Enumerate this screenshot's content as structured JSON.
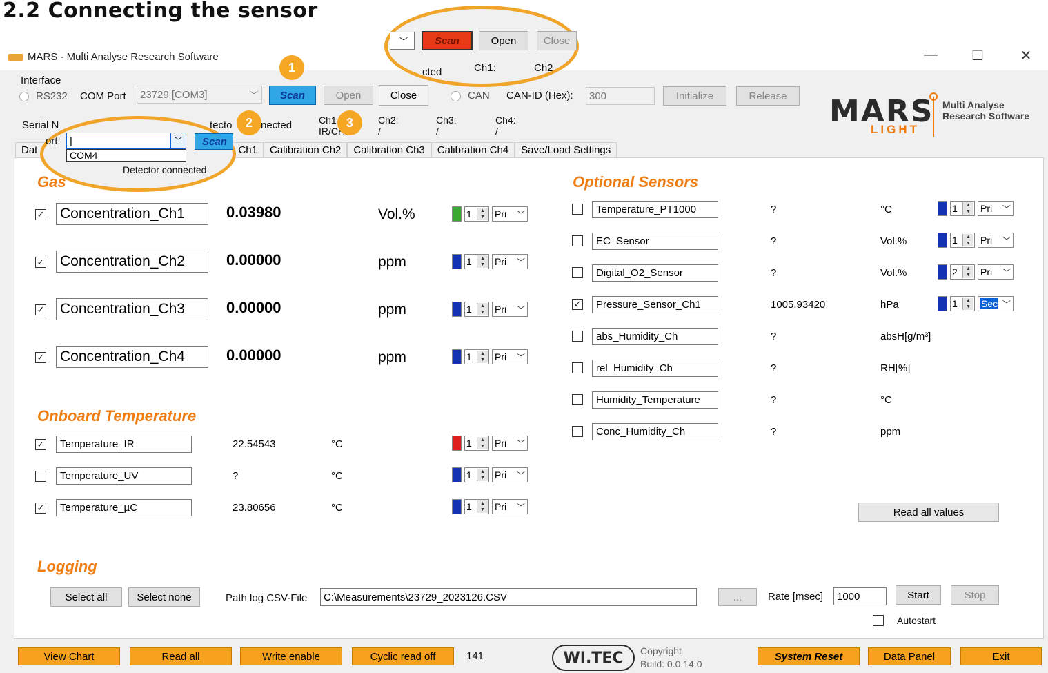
{
  "heading": "2.2 Connecting the sensor",
  "window": {
    "title": "MARS - Multi Analyse Research Software",
    "minimize": "—",
    "maximize": "☐",
    "close": "✕"
  },
  "interface": {
    "label": "Interface",
    "rs232": "RS232",
    "com_port_label": "COM Port",
    "com_port_value": "23729 [COM3]",
    "scan": "Scan",
    "open": "Open",
    "close": "Close",
    "can": "CAN",
    "can_id_label": "CAN-ID (Hex):",
    "can_id_value": "300",
    "initialize": "Initialize",
    "release": "Release"
  },
  "status_row": {
    "serial": "Serial N",
    "detector": "tecto",
    "connected": "nected",
    "ch1": "Ch1",
    "ch1_sub": "IR/CH4",
    "ch2": "Ch2:",
    "ch2_sub": "/",
    "ch3": "Ch3:",
    "ch3_sub": "/",
    "ch4": "Ch4:",
    "ch4_sub": "/"
  },
  "tabs": [
    "Dat",
    "Ch1",
    "Calibration Ch2",
    "Calibration Ch3",
    "Calibration Ch4",
    "Save/Load Settings"
  ],
  "zoom1": {
    "scan": "Scan",
    "open": "Open",
    "close": "Close",
    "connected": "cted",
    "ch1": "Ch1:",
    "ch2": "Ch2"
  },
  "zoom2": {
    "port": "ort",
    "value": "|",
    "option": "COM4",
    "scan": "Scan",
    "status": "Detector connected",
    "gas": "Gas"
  },
  "badges": [
    "1",
    "2",
    "3"
  ],
  "gas": {
    "rows": [
      {
        "checked": true,
        "name": "Concentration_Ch1",
        "value": "0.03980",
        "unit": "Vol.%",
        "color": "#3aa832",
        "num": "1",
        "prio": "Pri"
      },
      {
        "checked": true,
        "name": "Concentration_Ch2",
        "value": "0.00000",
        "unit": "ppm",
        "color": "#1432b4",
        "num": "1",
        "prio": "Pri"
      },
      {
        "checked": true,
        "name": "Concentration_Ch3",
        "value": "0.00000",
        "unit": "ppm",
        "color": "#1432b4",
        "num": "1",
        "prio": "Pri"
      },
      {
        "checked": true,
        "name": "Concentration_Ch4",
        "value": "0.00000",
        "unit": "ppm",
        "color": "#1432b4",
        "num": "1",
        "prio": "Pri"
      }
    ]
  },
  "onboard": {
    "title": "Onboard Temperature",
    "rows": [
      {
        "checked": true,
        "name": "Temperature_IR",
        "value": "22.54543",
        "unit": "°C",
        "color": "#e01e1e",
        "num": "1",
        "prio": "Pri"
      },
      {
        "checked": false,
        "name": "Temperature_UV",
        "value": "?",
        "unit": "°C",
        "color": "#1432b4",
        "num": "1",
        "prio": "Pri"
      },
      {
        "checked": true,
        "name": "Temperature_µC",
        "value": "23.80656",
        "unit": "°C",
        "color": "#1432b4",
        "num": "1",
        "prio": "Pri"
      }
    ]
  },
  "optional": {
    "title": "Optional Sensors",
    "rows": [
      {
        "checked": false,
        "name": "Temperature_PT1000",
        "value": "?",
        "unit": "°C",
        "color": "#1432b4",
        "num": "1",
        "prio": "Pri"
      },
      {
        "checked": false,
        "name": "EC_Sensor",
        "value": "?",
        "unit": "Vol.%",
        "color": "#1432b4",
        "num": "1",
        "prio": "Pri"
      },
      {
        "checked": false,
        "name": "Digital_O2_Sensor",
        "value": "?",
        "unit": "Vol.%",
        "color": "#1432b4",
        "num": "2",
        "prio": "Pri"
      },
      {
        "checked": true,
        "name": "Pressure_Sensor_Ch1",
        "value": "1005.93420",
        "unit": "hPa",
        "color": "#1432b4",
        "num": "1",
        "prio": "Sec"
      },
      {
        "checked": false,
        "name": "abs_Humidity_Ch",
        "value": "?",
        "unit": "absH[g/m³]"
      },
      {
        "checked": false,
        "name": "rel_Humidity_Ch",
        "value": "?",
        "unit": "RH[%]"
      },
      {
        "checked": false,
        "name": "Humidity_Temperature",
        "value": "?",
        "unit": "°C"
      },
      {
        "checked": false,
        "name": "Conc_Humidity_Ch",
        "value": "?",
        "unit": "ppm"
      }
    ],
    "read_all": "Read all values"
  },
  "logging": {
    "title": "Logging",
    "select_all": "Select all",
    "select_none": "Select none",
    "path_label": "Path log CSV-File",
    "path_value": "C:\\Measurements\\23729_2023126.CSV",
    "browse": "...",
    "rate_label": "Rate [msec]",
    "rate_value": "1000",
    "start": "Start",
    "stop": "Stop",
    "autostart": "Autostart"
  },
  "footer": {
    "view_chart": "View Chart",
    "read_all": "Read all",
    "write_enable": "Write enable",
    "cyclic": "Cyclic read off",
    "count": "141",
    "witec": "WI.TEC",
    "copyright": "Copyright",
    "build": "Build: 0.0.14.0",
    "system_reset": "System Reset",
    "data_panel": "Data Panel",
    "exit": "Exit"
  },
  "logo": {
    "mars": "MARS",
    "light": "LIGHT",
    "tagline": "Multi Analyse\nResearch Software"
  }
}
